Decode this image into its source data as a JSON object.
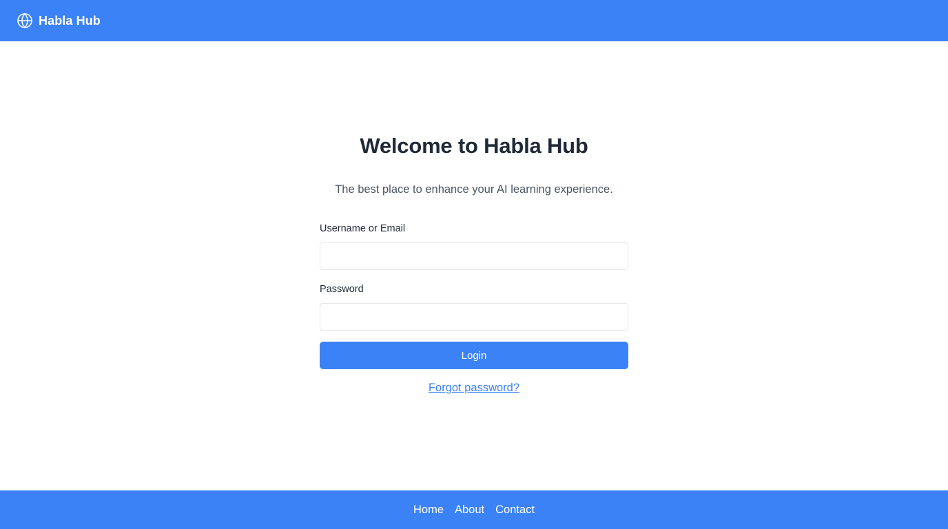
{
  "header": {
    "brand_name": "Habla Hub",
    "brand_icon": "globe-icon"
  },
  "main": {
    "title": "Welcome to Habla Hub",
    "subtitle": "The best place to enhance your AI learning experience.",
    "form": {
      "username_label": "Username or Email",
      "username_value": "",
      "password_label": "Password",
      "password_value": "",
      "login_label": "Login",
      "forgot_label": "Forgot password?"
    }
  },
  "footer": {
    "links": [
      "Home",
      "About",
      "Contact"
    ]
  },
  "colors": {
    "accent": "#3b82f6",
    "heading": "#1f2937",
    "subtext": "#4b5563",
    "input_border": "#e5e7eb"
  }
}
